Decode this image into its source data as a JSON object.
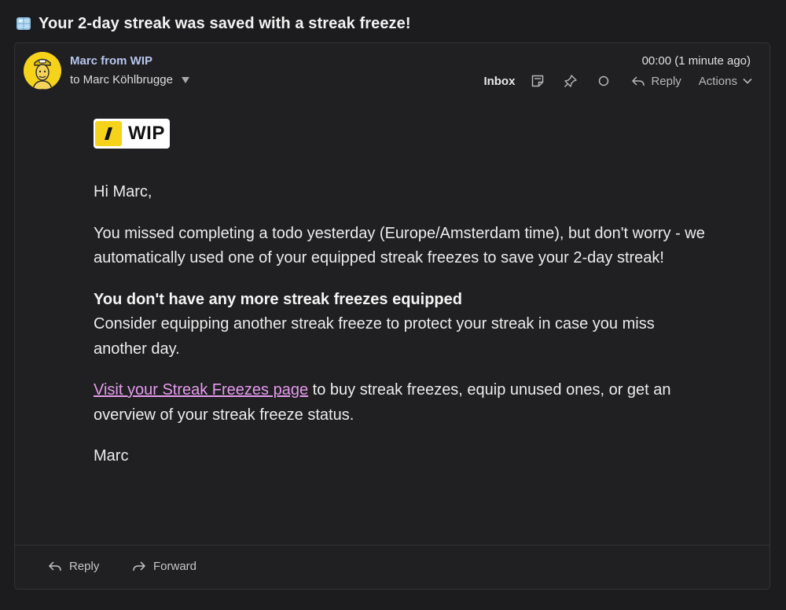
{
  "subject": "Your 2-day streak was saved with a streak freeze!",
  "subject_icon": "ice-cube-icon",
  "sender": {
    "name": "Marc from WIP",
    "recipient": "to Marc Köhlbrugge"
  },
  "timestamp": "00:00 (1 minute ago)",
  "toolbar": {
    "folder": "Inbox",
    "reply": "Reply",
    "actions": "Actions"
  },
  "email": {
    "logo_text": "WIP",
    "greeting": "Hi Marc,",
    "para1": "You missed completing a todo yesterday (Europe/Amsterdam time), but don't worry - we automatically used one of your equipped streak freezes to save your 2-day streak!",
    "heading": "You don't have any more streak freezes equipped",
    "para2": "Consider equipping another streak freeze to protect your streak in case you miss another day.",
    "link_text": "Visit your Streak Freezes page",
    "para3_rest": " to buy streak freezes, equip unused ones, or get an overview of your streak freeze status.",
    "signoff": "Marc"
  },
  "footer": {
    "reply": "Reply",
    "forward": "Forward"
  },
  "colors": {
    "background": "#1c1c1e",
    "card": "#202022",
    "sender": "#b7c6ee",
    "link": "#e69bee",
    "brand_yellow": "#f5d31b"
  }
}
